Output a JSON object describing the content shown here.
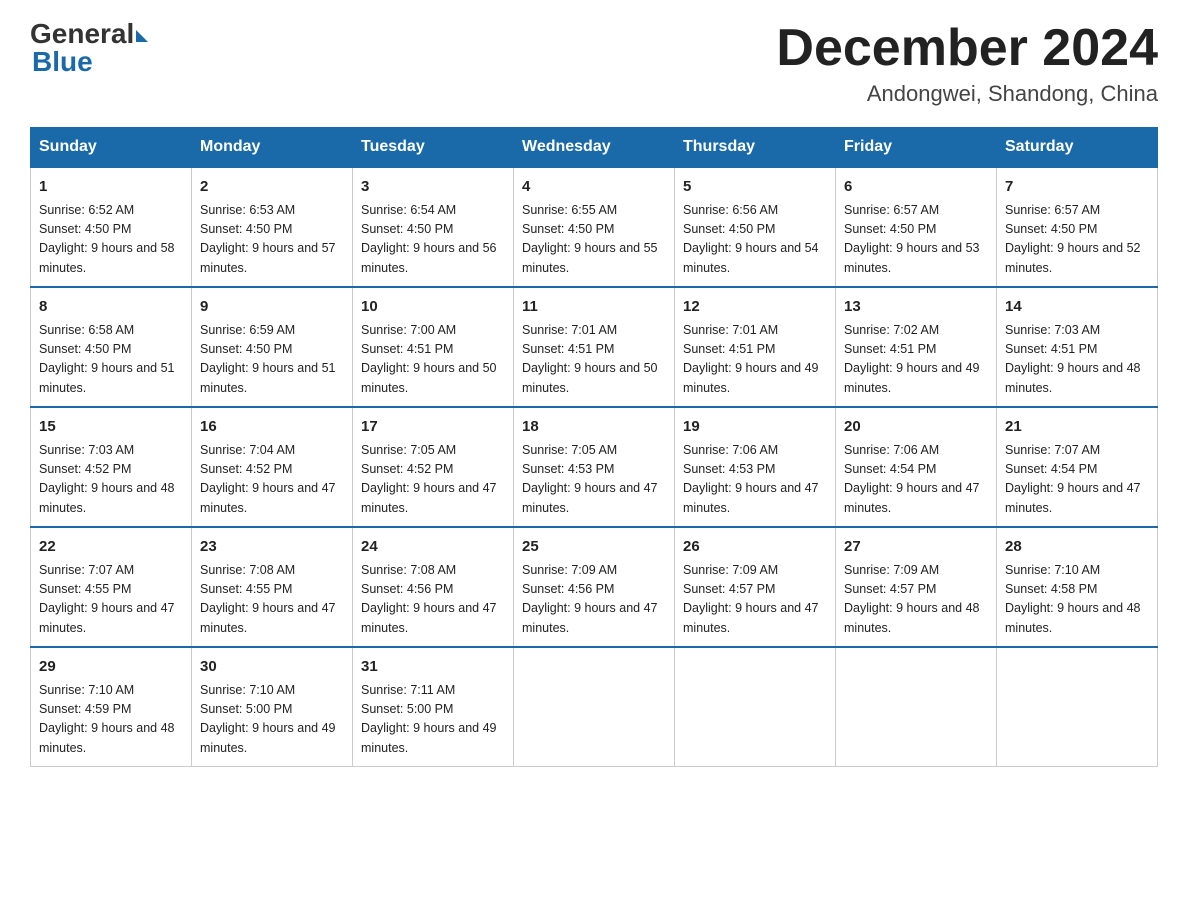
{
  "header": {
    "logo_general": "General",
    "logo_blue": "Blue",
    "month_title": "December 2024",
    "location": "Andongwei, Shandong, China"
  },
  "days_of_week": [
    "Sunday",
    "Monday",
    "Tuesday",
    "Wednesday",
    "Thursday",
    "Friday",
    "Saturday"
  ],
  "weeks": [
    [
      {
        "day": "1",
        "sunrise": "6:52 AM",
        "sunset": "4:50 PM",
        "daylight": "9 hours and 58 minutes."
      },
      {
        "day": "2",
        "sunrise": "6:53 AM",
        "sunset": "4:50 PM",
        "daylight": "9 hours and 57 minutes."
      },
      {
        "day": "3",
        "sunrise": "6:54 AM",
        "sunset": "4:50 PM",
        "daylight": "9 hours and 56 minutes."
      },
      {
        "day": "4",
        "sunrise": "6:55 AM",
        "sunset": "4:50 PM",
        "daylight": "9 hours and 55 minutes."
      },
      {
        "day": "5",
        "sunrise": "6:56 AM",
        "sunset": "4:50 PM",
        "daylight": "9 hours and 54 minutes."
      },
      {
        "day": "6",
        "sunrise": "6:57 AM",
        "sunset": "4:50 PM",
        "daylight": "9 hours and 53 minutes."
      },
      {
        "day": "7",
        "sunrise": "6:57 AM",
        "sunset": "4:50 PM",
        "daylight": "9 hours and 52 minutes."
      }
    ],
    [
      {
        "day": "8",
        "sunrise": "6:58 AM",
        "sunset": "4:50 PM",
        "daylight": "9 hours and 51 minutes."
      },
      {
        "day": "9",
        "sunrise": "6:59 AM",
        "sunset": "4:50 PM",
        "daylight": "9 hours and 51 minutes."
      },
      {
        "day": "10",
        "sunrise": "7:00 AM",
        "sunset": "4:51 PM",
        "daylight": "9 hours and 50 minutes."
      },
      {
        "day": "11",
        "sunrise": "7:01 AM",
        "sunset": "4:51 PM",
        "daylight": "9 hours and 50 minutes."
      },
      {
        "day": "12",
        "sunrise": "7:01 AM",
        "sunset": "4:51 PM",
        "daylight": "9 hours and 49 minutes."
      },
      {
        "day": "13",
        "sunrise": "7:02 AM",
        "sunset": "4:51 PM",
        "daylight": "9 hours and 49 minutes."
      },
      {
        "day": "14",
        "sunrise": "7:03 AM",
        "sunset": "4:51 PM",
        "daylight": "9 hours and 48 minutes."
      }
    ],
    [
      {
        "day": "15",
        "sunrise": "7:03 AM",
        "sunset": "4:52 PM",
        "daylight": "9 hours and 48 minutes."
      },
      {
        "day": "16",
        "sunrise": "7:04 AM",
        "sunset": "4:52 PM",
        "daylight": "9 hours and 47 minutes."
      },
      {
        "day": "17",
        "sunrise": "7:05 AM",
        "sunset": "4:52 PM",
        "daylight": "9 hours and 47 minutes."
      },
      {
        "day": "18",
        "sunrise": "7:05 AM",
        "sunset": "4:53 PM",
        "daylight": "9 hours and 47 minutes."
      },
      {
        "day": "19",
        "sunrise": "7:06 AM",
        "sunset": "4:53 PM",
        "daylight": "9 hours and 47 minutes."
      },
      {
        "day": "20",
        "sunrise": "7:06 AM",
        "sunset": "4:54 PM",
        "daylight": "9 hours and 47 minutes."
      },
      {
        "day": "21",
        "sunrise": "7:07 AM",
        "sunset": "4:54 PM",
        "daylight": "9 hours and 47 minutes."
      }
    ],
    [
      {
        "day": "22",
        "sunrise": "7:07 AM",
        "sunset": "4:55 PM",
        "daylight": "9 hours and 47 minutes."
      },
      {
        "day": "23",
        "sunrise": "7:08 AM",
        "sunset": "4:55 PM",
        "daylight": "9 hours and 47 minutes."
      },
      {
        "day": "24",
        "sunrise": "7:08 AM",
        "sunset": "4:56 PM",
        "daylight": "9 hours and 47 minutes."
      },
      {
        "day": "25",
        "sunrise": "7:09 AM",
        "sunset": "4:56 PM",
        "daylight": "9 hours and 47 minutes."
      },
      {
        "day": "26",
        "sunrise": "7:09 AM",
        "sunset": "4:57 PM",
        "daylight": "9 hours and 47 minutes."
      },
      {
        "day": "27",
        "sunrise": "7:09 AM",
        "sunset": "4:57 PM",
        "daylight": "9 hours and 48 minutes."
      },
      {
        "day": "28",
        "sunrise": "7:10 AM",
        "sunset": "4:58 PM",
        "daylight": "9 hours and 48 minutes."
      }
    ],
    [
      {
        "day": "29",
        "sunrise": "7:10 AM",
        "sunset": "4:59 PM",
        "daylight": "9 hours and 48 minutes."
      },
      {
        "day": "30",
        "sunrise": "7:10 AM",
        "sunset": "5:00 PM",
        "daylight": "9 hours and 49 minutes."
      },
      {
        "day": "31",
        "sunrise": "7:11 AM",
        "sunset": "5:00 PM",
        "daylight": "9 hours and 49 minutes."
      },
      null,
      null,
      null,
      null
    ]
  ]
}
